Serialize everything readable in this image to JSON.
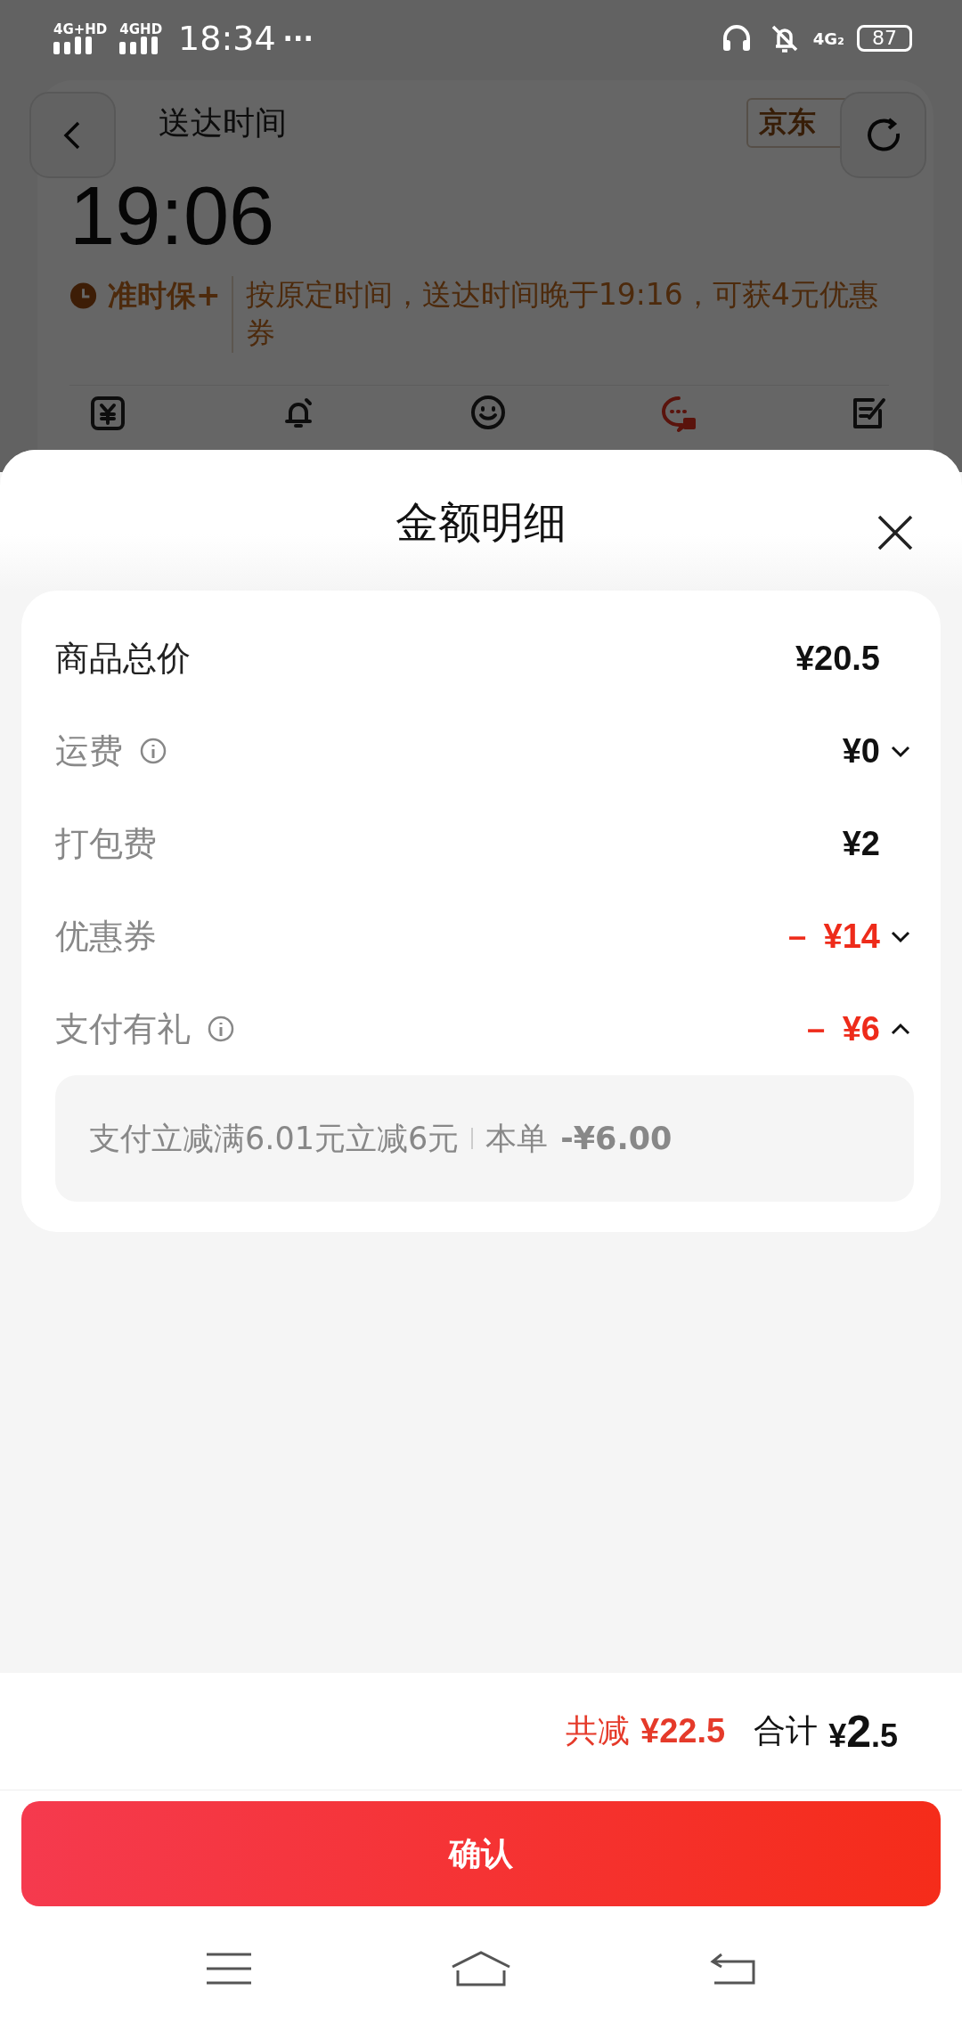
{
  "status_bar": {
    "signal_labels": [
      "4G+HD",
      "4GHD"
    ],
    "time": "18:34",
    "more": "···",
    "network": "4G₂",
    "battery": "87"
  },
  "background_page": {
    "header_label": "送达时间",
    "badge": "京东",
    "delivery_time": "19:06",
    "guarantee": {
      "label": "准时保+",
      "text": "按原定时间，送达时间晚于19:16，可获4元优惠券"
    },
    "actions": [
      {
        "kind": "yuan",
        "selected": false
      },
      {
        "kind": "bell",
        "selected": false
      },
      {
        "kind": "smile",
        "selected": false
      },
      {
        "kind": "chat",
        "selected": true
      },
      {
        "kind": "note",
        "selected": false
      }
    ]
  },
  "sheet": {
    "title": "金额明细",
    "rows": [
      {
        "label": "商品总价",
        "value": "¥20.5",
        "kind": "total",
        "info": false,
        "discount": false
      },
      {
        "label": "运费",
        "value": "¥0",
        "kind": "fee",
        "info": true,
        "discount": false,
        "expanded": false
      },
      {
        "label": "打包费",
        "value": "¥2",
        "kind": "fee",
        "info": false,
        "discount": false
      },
      {
        "label": "优惠券",
        "value": "－ ¥14",
        "kind": "fee",
        "info": false,
        "discount": true,
        "expanded": false
      },
      {
        "label": "支付有礼",
        "value": "－ ¥6",
        "kind": "fee",
        "info": true,
        "discount": true,
        "expanded": true
      }
    ],
    "detail": {
      "text": "支付立减满6.01元立减6元",
      "order_label": "本单",
      "amount": "-¥6.00"
    }
  },
  "footer": {
    "reduction_label": "共减",
    "reduction": "¥22.5",
    "total_label": "合计",
    "total_symbol": "¥",
    "total_whole": "2",
    "total_fraction": ".5"
  },
  "confirm_button": "确认"
}
